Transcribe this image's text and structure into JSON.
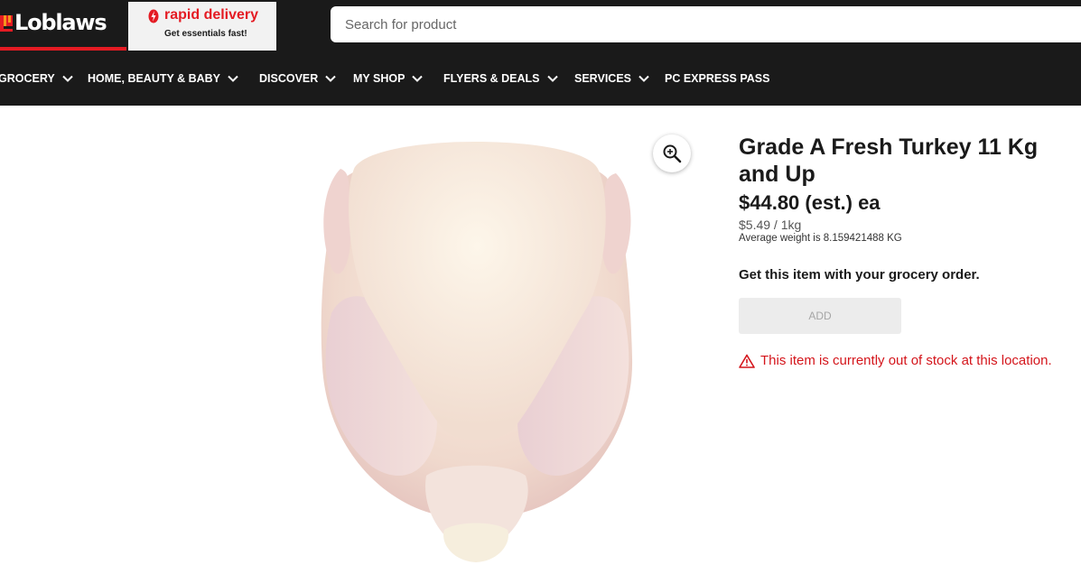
{
  "header": {
    "logo_text": "Loblaws",
    "rapid_title": "rapid delivery",
    "rapid_subtitle": "Get essentials fast!",
    "search_placeholder": "Search for product",
    "colors": {
      "header_bg": "#1a1a1a",
      "brand_red": "#e41b23"
    }
  },
  "nav": {
    "items": [
      {
        "label": "GROCERY",
        "has_dropdown": true
      },
      {
        "label": "HOME, BEAUTY & BABY",
        "has_dropdown": true
      },
      {
        "label": "DISCOVER",
        "has_dropdown": true
      },
      {
        "label": "MY SHOP",
        "has_dropdown": true
      },
      {
        "label": "FLYERS & DEALS",
        "has_dropdown": true
      },
      {
        "label": "SERVICES",
        "has_dropdown": true
      },
      {
        "label": "PC EXPRESS PASS",
        "has_dropdown": false
      }
    ]
  },
  "product": {
    "image_icon": "whole-raw-turkey",
    "zoom_icon": "zoom-in-icon",
    "title": "Grade A Fresh Turkey 11 Kg and Up",
    "price": "$44.80 (est.) ea",
    "unit_price": "$5.49 / 1kg",
    "average_weight": "Average weight is 8.159421488 KG",
    "get_item_text": "Get this item with your grocery order.",
    "add_label": "ADD",
    "out_of_stock": "This item is currently out of stock at this location.",
    "colors": {
      "warning": "#d4151b",
      "add_disabled_bg": "#ececec"
    }
  }
}
